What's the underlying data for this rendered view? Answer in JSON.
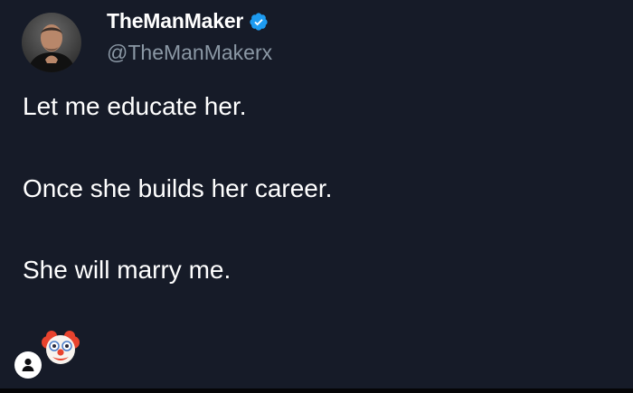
{
  "author": {
    "display_name": "TheManMaker",
    "handle": "@TheManMakerx",
    "verified": true,
    "verified_badge_color": "#1d9bf0",
    "avatar_icon": "profile-photo"
  },
  "tweet": {
    "lines": [
      "Let me educate her.",
      "Once she builds her career.",
      "She will marry me."
    ],
    "emoji": "clown-face"
  },
  "footer": {
    "badge_icon": "person-icon"
  },
  "colors": {
    "background": "#161b28",
    "text": "#ffffff",
    "handle": "#8b98a5"
  }
}
